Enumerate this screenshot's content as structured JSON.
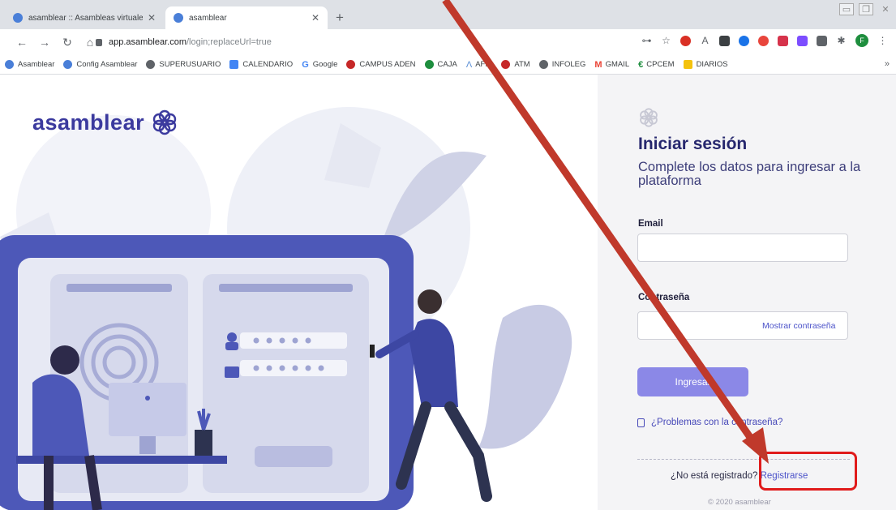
{
  "browser": {
    "tabs": [
      {
        "title": "asamblear :: Asambleas virtuales",
        "active": false
      },
      {
        "title": "asamblear",
        "active": true
      }
    ],
    "url_host": "app.asamblear.com",
    "url_path": "/login;replaceUrl=true",
    "bookmarks": [
      {
        "label": "Asamblear",
        "color": "#4a7fd8"
      },
      {
        "label": "Config Asamblear",
        "color": "#4a7fd8"
      },
      {
        "label": "SUPERUSUARIO",
        "color": "#5f6368"
      },
      {
        "label": "CALENDARIO",
        "color": "#4285f4"
      },
      {
        "label": "Google",
        "color": "#4285f4"
      },
      {
        "label": "CAMPUS ADEN",
        "color": "#c62828"
      },
      {
        "label": "CAJA",
        "color": "#1e8e3e"
      },
      {
        "label": "AFIP",
        "color": "#5b8fd6"
      },
      {
        "label": "ATM",
        "color": "#c62828"
      },
      {
        "label": "INFOLEG",
        "color": "#5f6368"
      },
      {
        "label": "GMAIL",
        "color": "#ea4335"
      },
      {
        "label": "CPCEM",
        "color": "#1e8e3e"
      },
      {
        "label": "DIARIOS",
        "color": "#f4c20d"
      }
    ],
    "bookmarks_more": "»",
    "profile_initial": "F"
  },
  "brand": {
    "name": "asamblear",
    "color": "#3b3a9e"
  },
  "login": {
    "title": "Iniciar sesión",
    "subtitle": "Complete los datos para ingresar a la plataforma",
    "email_label": "Email",
    "email_value": "",
    "password_label": "Contraseña",
    "password_value": "",
    "show_password": "Mostrar contraseña",
    "submit": "Ingresar",
    "problems_link": "¿Problemas con la contraseña?",
    "not_registered": "¿No está registrado?",
    "register_link": "Registrarse",
    "copyright": "© 2020 asamblear"
  },
  "annotation": {
    "color": "#c0392b",
    "highlight_color": "#e01b1b"
  }
}
